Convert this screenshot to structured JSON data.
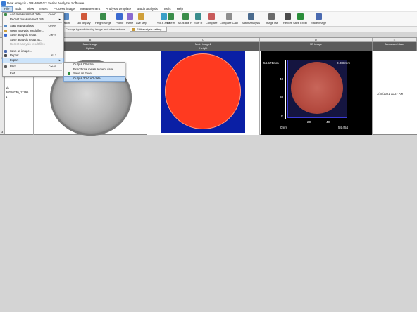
{
  "window": {
    "title": "New analysis - VR-3000 G2 Series Analyzer Software"
  },
  "menubar": [
    "File",
    "Edit",
    "View",
    "Insert",
    "Process image",
    "Measurement",
    "Analysis template",
    "Batch analysis",
    "Tools",
    "Help"
  ],
  "toolbar": [
    {
      "label": "...ation",
      "icon": "data-icon",
      "color": "#5a8dc8"
    },
    {
      "label": "3D display",
      "icon": "3d-display-icon",
      "color": "#d0583a"
    },
    {
      "label": "Height range",
      "icon": "height-range-icon",
      "color": "#3a8d4a"
    },
    {
      "label": "Profile",
      "icon": "profile-icon",
      "color": "#3a6ad0"
    },
    {
      "label": "Plane",
      "icon": "plane-icon",
      "color": "#8a6ad0"
    },
    {
      "label": "Ave step",
      "icon": "ave-step-icon",
      "color": "#d0a03a"
    },
    {
      "label": "Vol & area",
      "icon": "volume-area-icon",
      "color": "#3aa0c8"
    },
    {
      "label": "Line R",
      "icon": "line-roughness-icon",
      "color": "#3a8d4a"
    },
    {
      "label": "Multi-line R",
      "icon": "multi-line-roughness-icon",
      "color": "#3a8d4a"
    },
    {
      "label": "Surf R",
      "icon": "surface-roughness-icon",
      "color": "#3a8d8d"
    },
    {
      "label": "Compare",
      "icon": "compare-icon",
      "color": "#c85a5a"
    },
    {
      "label": "Compare CAD",
      "icon": "compare-cad-icon",
      "color": "#8d8d8d"
    },
    {
      "label": "Batch Analysis",
      "icon": "batch-analysis-icon",
      "color": "#4a6a8d"
    },
    {
      "label": "Image list",
      "icon": "image-list-icon",
      "color": "#6a6a6a"
    },
    {
      "label": "Report",
      "icon": "report-icon",
      "color": "#4a4a4a"
    },
    {
      "label": "Save Excel",
      "icon": "save-excel-icon",
      "color": "#2a8d3a"
    },
    {
      "label": "Save image",
      "icon": "save-image-icon",
      "color": "#4a6ab0"
    }
  ],
  "subbar": {
    "hint": "Change type of display image and other actions",
    "edit_button": "Edit analysis setting..."
  },
  "grid": {
    "columns": [
      {
        "letter": "B",
        "title": "Main image",
        "sub": "Optical"
      },
      {
        "letter": "C",
        "title": "Main image2",
        "sub": "Height"
      },
      {
        "letter": "D",
        "title": "3D image",
        "sub": ""
      },
      {
        "letter": "E",
        "title": "Measured date",
        "sub": ""
      }
    ],
    "row_number": "1",
    "row_number2": "3",
    "partial_cell_text": [
      "ab",
      "20210330_11295",
      "1"
    ],
    "measured_date": "3/30/2021 11:27 AM"
  },
  "plot3d": {
    "top_left_label": "54.571mm",
    "top_right_label": "0.088mm",
    "bottom_right_label": "54.454",
    "bottom_left_label": "0mm",
    "y_ticks": [
      "40",
      "20",
      "0"
    ],
    "x_ticks": [
      "20",
      "40"
    ]
  },
  "file_menu": {
    "items": [
      {
        "label": "Add measurement data...",
        "shortcut": "Ctrl+D",
        "icon": "add-data-icon",
        "color": "#3a8d4a"
      },
      {
        "label": "Recent measurement data",
        "shortcut": "",
        "arrow": "►",
        "icon": "",
        "color": ""
      },
      {
        "sep": true
      },
      {
        "label": "Start new analysis",
        "shortcut": "Ctrl+N",
        "icon": "new-analysis-icon",
        "color": "#5a8dc8"
      },
      {
        "label": "Open analysis result file...",
        "shortcut": "",
        "icon": "open-folder-icon",
        "color": "#d0a03a"
      },
      {
        "label": "Save analysis result",
        "shortcut": "Ctrl+S",
        "icon": "save-icon",
        "color": "#3a6ad0"
      },
      {
        "label": "Save analysis result as...",
        "shortcut": "",
        "icon": "",
        "color": ""
      },
      {
        "label": "Recent analysis result files",
        "shortcut": "",
        "disabled": true,
        "icon": "",
        "color": ""
      },
      {
        "sep": true
      },
      {
        "label": "Save as image...",
        "shortcut": "",
        "icon": "save-image-icon",
        "color": "#4a6ab0"
      },
      {
        "label": "Report",
        "shortcut": "F12",
        "icon": "report-icon",
        "color": "#4a4a4a"
      },
      {
        "label": "Export",
        "shortcut": "",
        "arrow": "►",
        "highlight": true,
        "icon": "",
        "color": ""
      },
      {
        "sep": true
      },
      {
        "label": "Print...",
        "shortcut": "Ctrl+P",
        "icon": "print-icon",
        "color": "#5a5a5a"
      },
      {
        "sep": true
      },
      {
        "label": "Exit",
        "shortcut": "",
        "icon": "",
        "color": ""
      }
    ]
  },
  "export_submenu": {
    "items": [
      {
        "label": "Output CSV file...",
        "highlight": false
      },
      {
        "label": "Export raw measurement data...",
        "highlight": false
      },
      {
        "label": "Save as Excel...",
        "highlight": false,
        "icon": "excel-icon",
        "color": "#2a8d3a"
      },
      {
        "label": "Output 3D-CAD data...",
        "highlight": true
      }
    ]
  }
}
